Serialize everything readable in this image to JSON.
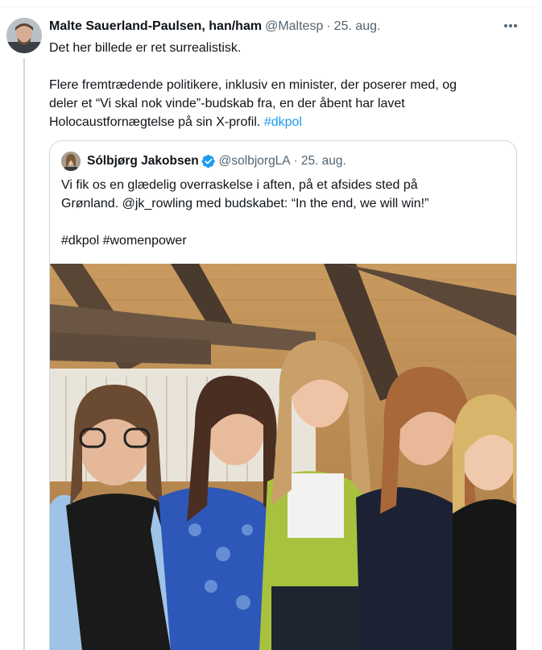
{
  "tweet": {
    "author_name": "Malte Sauerland-Paulsen, han/ham",
    "author_handle": "@Maltesp",
    "separator": "·",
    "date": "25. aug.",
    "more_icon": "more-horizontal-icon",
    "line1": "Det her billede er ret surrealistisk.",
    "para2_line1": "Flere fremtrædende politikere, inklusiv en minister, der poserer med, og",
    "para2_line2": "deler et “Vi skal nok vinde”-budskab fra, en der åbent har lavet",
    "para2_line3_text": "Holocaustfornægtelse på sin X-profil.",
    "hashtag": "#dkpol"
  },
  "quote": {
    "author_name": "Sólbjørg Jakobsen",
    "verified_icon": "verified-badge-icon",
    "author_handle": "@solbjorgLA",
    "separator": "·",
    "date": "25. aug.",
    "line1": "Vi fik os en glædelig overraskelse i aften, på et afsides sted på",
    "line2": "Grønland. @jk_rowling med budskabet: “In the end, we will win!”",
    "line3": "#dkpol #womenpower",
    "photo": "group-photo"
  },
  "colors": {
    "link": "#1d9bf0",
    "secondary_text": "#536471",
    "border": "#cfd9de",
    "verified": "#1d9bf0"
  }
}
